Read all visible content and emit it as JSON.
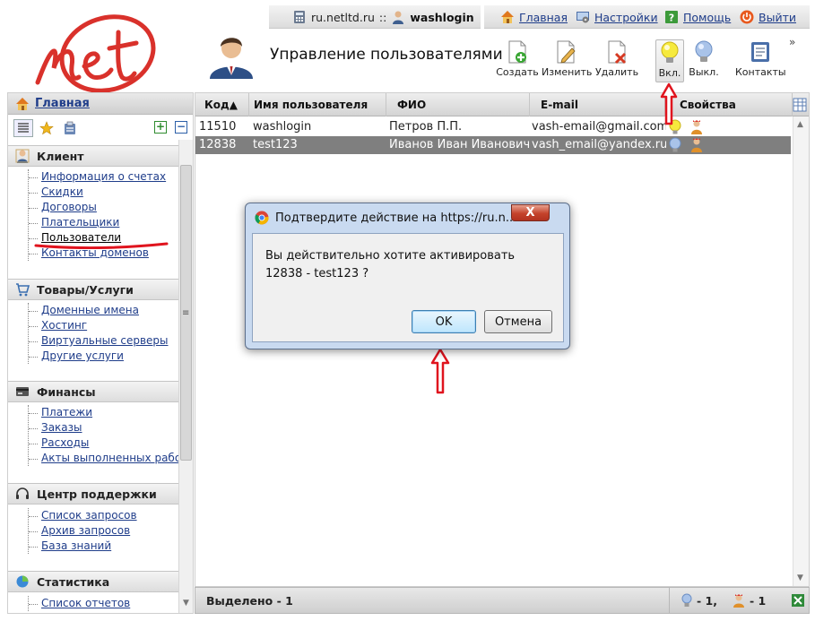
{
  "header": {
    "site": "ru.netltd.ru",
    "site_sep": "::",
    "username": "washlogin",
    "links": {
      "home": "Главная",
      "settings": "Настройки",
      "help": "Помощь",
      "logout": "Выйти"
    },
    "page_title": "Управление пользователями",
    "toolbar": {
      "create": "Создать",
      "edit": "Изменить",
      "delete": "Удалить",
      "enable": "Вкл.",
      "disable": "Выкл.",
      "contacts": "Контакты",
      "more": "»"
    }
  },
  "sidebar": {
    "home_label": "Главная",
    "sections": [
      {
        "title": "Клиент",
        "icon": "client-icon",
        "items": [
          "Информация о счетах",
          "Скидки",
          "Договоры",
          "Плательщики",
          "Пользователи",
          "Контакты доменов"
        ]
      },
      {
        "title": "Товары/Услуги",
        "icon": "cart-icon",
        "items": [
          "Доменные имена",
          "Хостинг",
          "Виртуальные серверы",
          "Другие услуги"
        ]
      },
      {
        "title": "Финансы",
        "icon": "finance-icon",
        "items": [
          "Платежи",
          "Заказы",
          "Расходы",
          "Акты выполненных работ"
        ]
      },
      {
        "title": "Центр поддержки",
        "icon": "headset-icon",
        "items": [
          "Список запросов",
          "Архив запросов",
          "База знаний"
        ]
      },
      {
        "title": "Статистика",
        "icon": "pie-chart-icon",
        "items": [
          "Список отчетов"
        ]
      }
    ],
    "tools": {
      "plus": "+",
      "minus": "−",
      "grip": "≡"
    }
  },
  "grid": {
    "columns": [
      "Код▲",
      "Имя пользователя",
      "ФИО",
      "E-mail",
      "Свойства"
    ],
    "rows": [
      {
        "code": "11510",
        "username": "washlogin",
        "fio": "Петров П.П.",
        "email": "vash-email@gmail.com",
        "enabled": true
      },
      {
        "code": "12838",
        "username": "test123",
        "fio": "Иванов Иван Иванович",
        "email": "vash_email@yandex.ru",
        "enabled": false
      }
    ],
    "status": {
      "selected": "Выделено - 1",
      "count_disabled": "- 1,",
      "count_users": "- 1"
    }
  },
  "dialog": {
    "title": "Подтвердите действие на https://ru.n...",
    "close": "X",
    "message_line1": "Вы действительно хотите активировать",
    "message_line2": "12838 - test123 ?",
    "ok": "OK",
    "cancel": "Отмена"
  },
  "colors": {
    "logo_red": "#d9312b",
    "selected_row": "#7f7f7f",
    "annotation_red": "#e0141e",
    "dialog_frame": "#c9daf0",
    "link": "#1f3d8a"
  }
}
